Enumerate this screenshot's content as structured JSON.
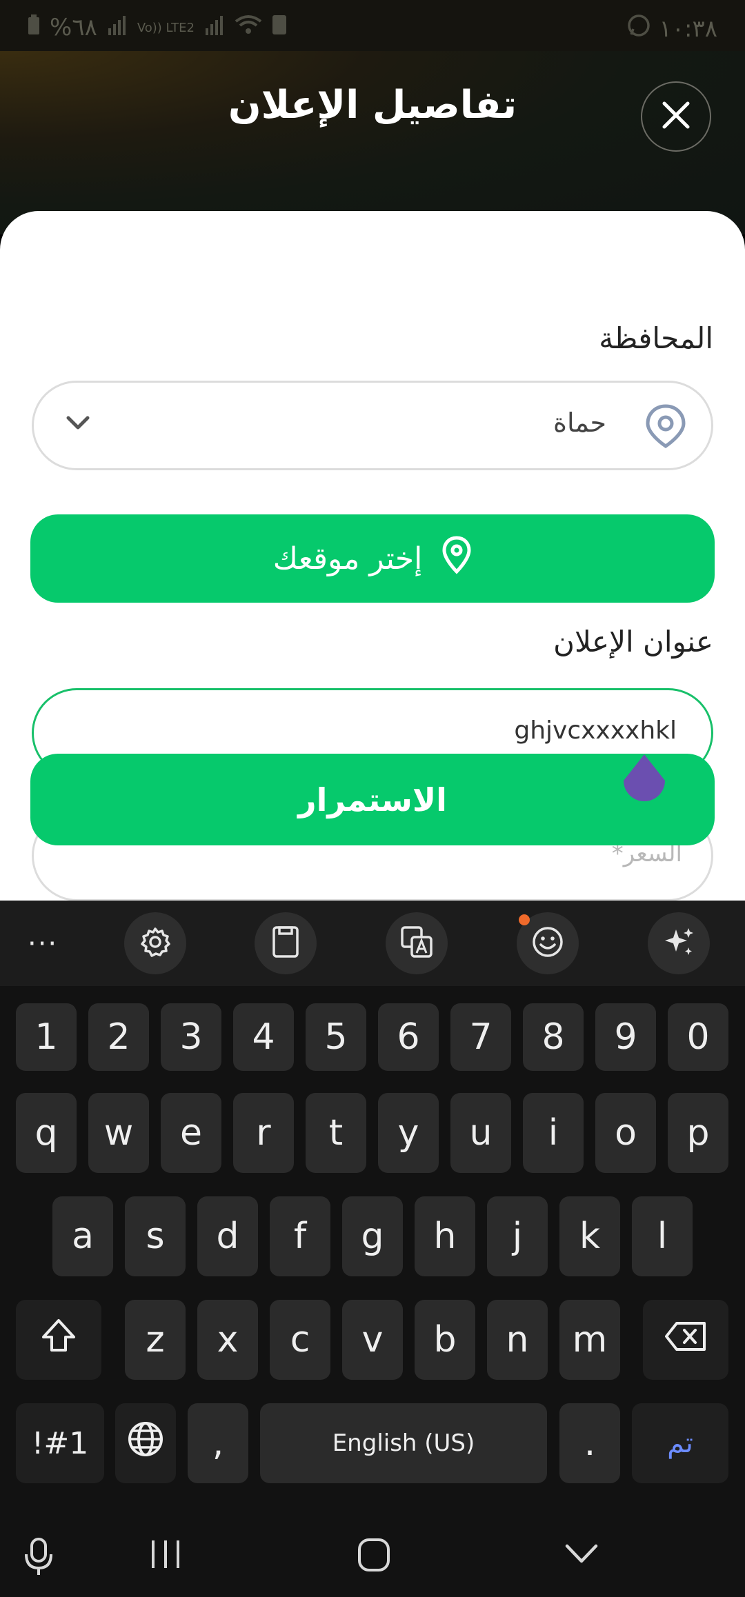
{
  "status_bar": {
    "battery": "%٦٨",
    "signal": "Vo)) LTE2",
    "time": "١٠:٣٨"
  },
  "header": {
    "title": "تفاصيل الإعلان"
  },
  "form": {
    "province_label": "المحافظة",
    "province_value": "حماة",
    "choose_location_label": "إختر موقعك",
    "ad_title_label": "عنوان الإعلان",
    "ad_title_value": "ghjvcxxxxhkl",
    "price_placeholder": "السعر*",
    "continue_label": "الاستمرار"
  },
  "keyboard": {
    "toolbar": {
      "more": "···",
      "icons": [
        "gear-icon",
        "clipboard-icon",
        "translate-icon",
        "emoji-icon",
        "ai-sparkle-icon"
      ]
    },
    "row_numbers": [
      "1",
      "2",
      "3",
      "4",
      "5",
      "6",
      "7",
      "8",
      "9",
      "0"
    ],
    "row_1": [
      "q",
      "w",
      "e",
      "r",
      "t",
      "y",
      "u",
      "i",
      "o",
      "p"
    ],
    "row_2": [
      "a",
      "s",
      "d",
      "f",
      "g",
      "h",
      "j",
      "k",
      "l"
    ],
    "row_3": [
      "z",
      "x",
      "c",
      "v",
      "b",
      "n",
      "m"
    ],
    "symbols_key": "!#1",
    "comma_key": ",",
    "space_key": "English (US)",
    "period_key": ".",
    "done_key": "تم"
  },
  "colors": {
    "accent_green": "#06c96c",
    "focus_border": "#18c06a",
    "handle_purple": "#6b4fb0",
    "done_blue": "#6c8cff"
  }
}
